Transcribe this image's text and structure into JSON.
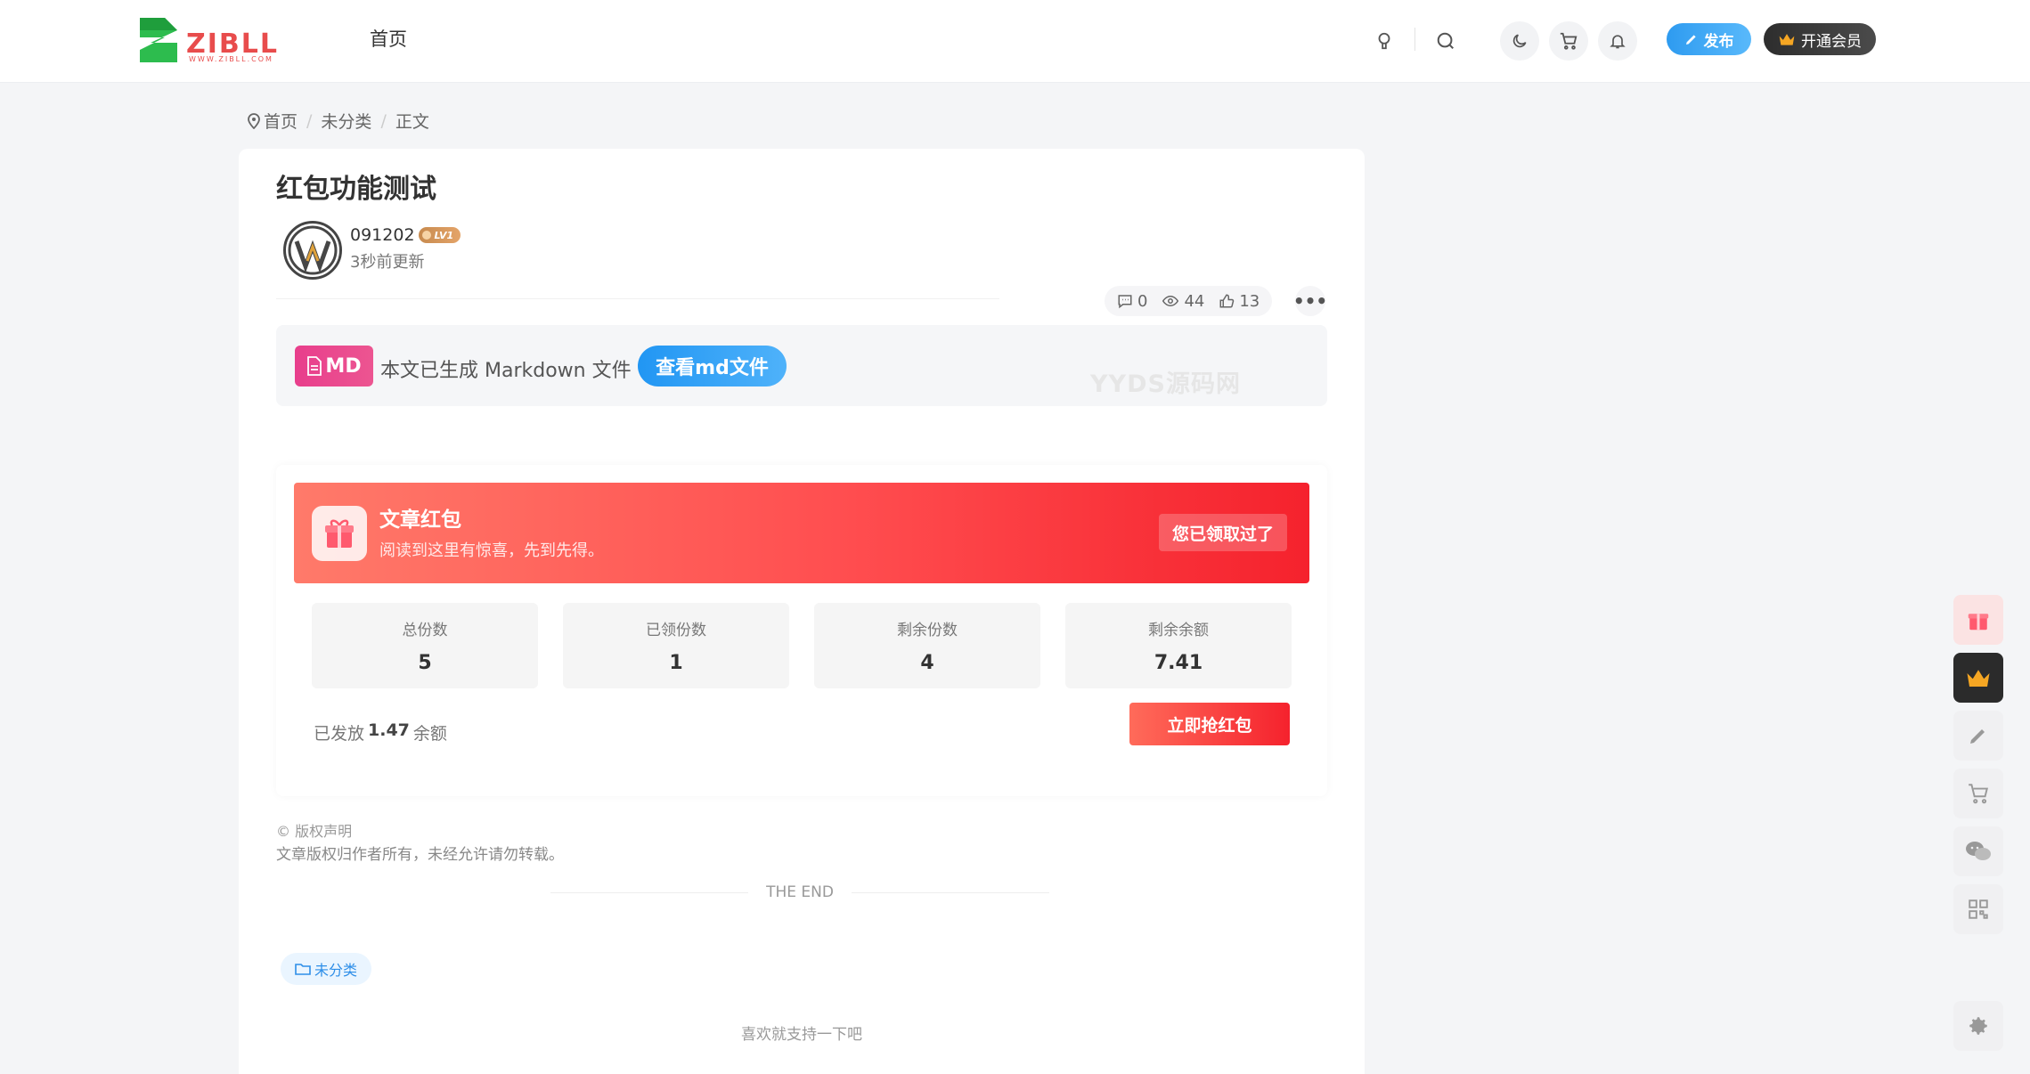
{
  "header": {
    "logo_text": "ZIBLL",
    "logo_subtext": "WWW.ZIBLL.COM",
    "nav_home": "首页",
    "publish_label": "发布",
    "vip_label": "开通会员"
  },
  "breadcrumb": {
    "items": [
      "首页",
      "未分类",
      "正文"
    ]
  },
  "article": {
    "title": "红包功能测试",
    "author": "091202",
    "level": "LV1",
    "update_time": "3秒前更新",
    "comments": "0",
    "views": "44",
    "likes": "13"
  },
  "markdown": {
    "badge": "MD",
    "text": "本文已生成 Markdown 文件",
    "button": "查看md文件"
  },
  "watermark": "YYDS源码网",
  "red_packet": {
    "title": "文章红包",
    "subtitle": "阅读到这里有惊喜，先到先得。",
    "claimed_label": "您已领取过了",
    "stats": [
      {
        "label": "总份数",
        "value": "5"
      },
      {
        "label": "已领份数",
        "value": "1"
      },
      {
        "label": "剩余份数",
        "value": "4"
      },
      {
        "label": "剩余余额",
        "value": "7.41"
      }
    ],
    "issued_prefix": "已发放",
    "issued_amount": "1.47",
    "issued_suffix": "余额",
    "grab_button": "立即抢红包"
  },
  "copyright": {
    "title": "© 版权声明",
    "text": "文章版权归作者所有，未经允许请勿转载。"
  },
  "the_end": "THE END",
  "tag": "未分类",
  "support_text": "喜欢就支持一下吧",
  "colors": {
    "accent_blue": "#2e9bf0",
    "red_packet": "#ff4d4f",
    "md_pink": "#e83e8c"
  }
}
